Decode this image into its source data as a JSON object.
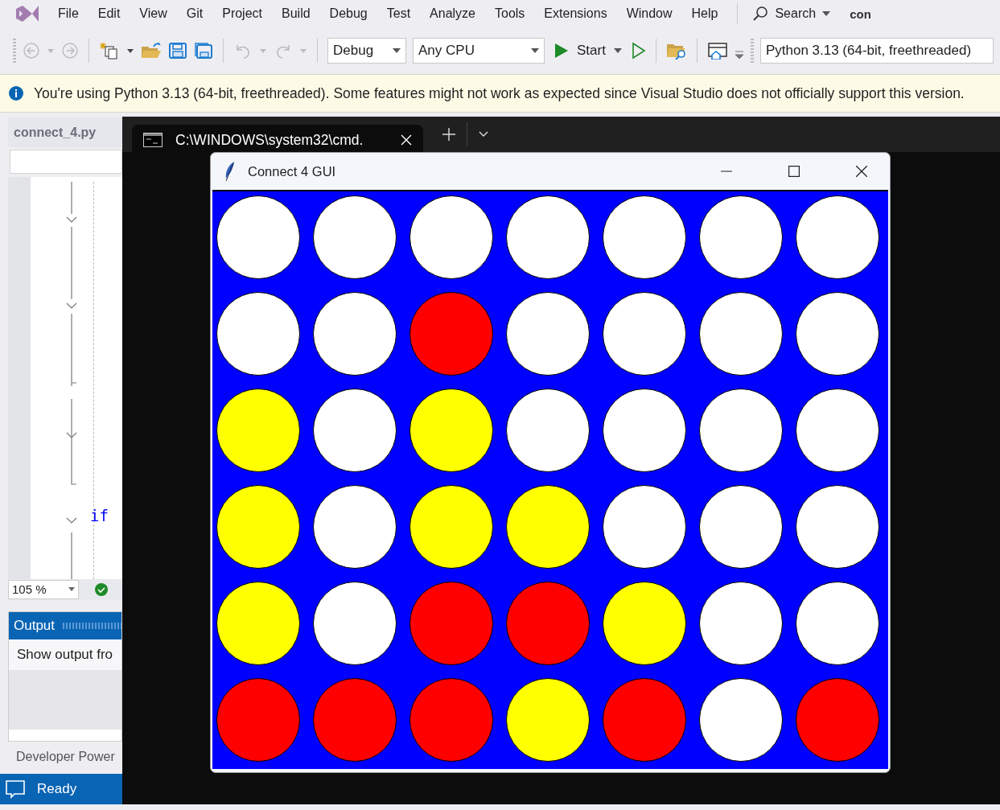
{
  "menu": {
    "items": [
      "File",
      "Edit",
      "View",
      "Git",
      "Project",
      "Build",
      "Debug",
      "Test",
      "Analyze",
      "Tools",
      "Extensions",
      "Window",
      "Help"
    ],
    "search": "Search",
    "account": "con"
  },
  "toolbar": {
    "configuration": "Debug",
    "platform": "Any CPU",
    "start": "Start",
    "environment": "Python 3.13 (64-bit, freethreaded)"
  },
  "info_bar": {
    "message": "You're using Python 3.13 (64-bit, freethreaded). Some features might not work as expected since Visual Studio does not officially support this version."
  },
  "editor": {
    "tab": "connect_4.py",
    "code_keyword": "if",
    "zoom": "105 %"
  },
  "output": {
    "title": "Output",
    "show_output_from": "Show output fro"
  },
  "developer_powershell": "Developer Power",
  "status_bar": {
    "text": "Ready"
  },
  "terminal": {
    "tab_title": "C:\\WINDOWS\\system32\\cmd."
  },
  "game_window": {
    "title": "Connect 4 GUI",
    "board": {
      "rows": [
        {
          "cells": [
            {
              "color": "#ffffff"
            },
            {
              "color": "#ffffff"
            },
            {
              "color": "#ffffff"
            },
            {
              "color": "#ffffff"
            },
            {
              "color": "#ffffff"
            },
            {
              "color": "#ffffff"
            },
            {
              "color": "#ffffff"
            }
          ]
        },
        {
          "cells": [
            {
              "color": "#ffffff"
            },
            {
              "color": "#ffffff"
            },
            {
              "color": "#ff0000"
            },
            {
              "color": "#ffffff"
            },
            {
              "color": "#ffffff"
            },
            {
              "color": "#ffffff"
            },
            {
              "color": "#ffffff"
            }
          ]
        },
        {
          "cells": [
            {
              "color": "#ffff00"
            },
            {
              "color": "#ffffff"
            },
            {
              "color": "#ffff00"
            },
            {
              "color": "#ffffff"
            },
            {
              "color": "#ffffff"
            },
            {
              "color": "#ffffff"
            },
            {
              "color": "#ffffff"
            }
          ]
        },
        {
          "cells": [
            {
              "color": "#ffff00"
            },
            {
              "color": "#ffffff"
            },
            {
              "color": "#ffff00"
            },
            {
              "color": "#ffff00"
            },
            {
              "color": "#ffffff"
            },
            {
              "color": "#ffffff"
            },
            {
              "color": "#ffffff"
            }
          ]
        },
        {
          "cells": [
            {
              "color": "#ffff00"
            },
            {
              "color": "#ffffff"
            },
            {
              "color": "#ff0000"
            },
            {
              "color": "#ff0000"
            },
            {
              "color": "#ffff00"
            },
            {
              "color": "#ffffff"
            },
            {
              "color": "#ffffff"
            }
          ]
        },
        {
          "cells": [
            {
              "color": "#ff0000"
            },
            {
              "color": "#ff0000"
            },
            {
              "color": "#ff0000"
            },
            {
              "color": "#ffff00"
            },
            {
              "color": "#ff0000"
            },
            {
              "color": "#ffffff"
            },
            {
              "color": "#ff0000"
            }
          ]
        }
      ]
    }
  }
}
